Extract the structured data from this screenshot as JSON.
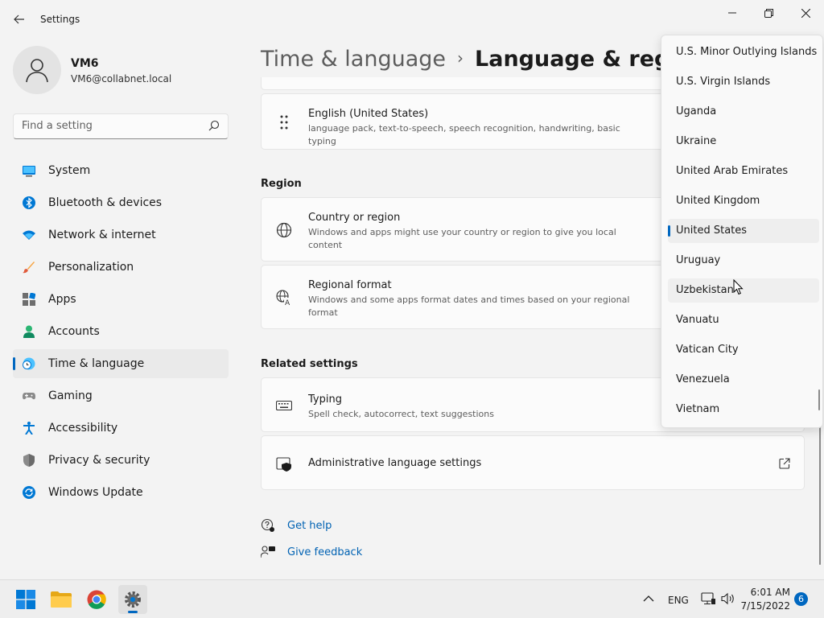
{
  "window": {
    "app_title": "Settings",
    "icons": {
      "back": "back-arrow-icon",
      "minimize": "minimize-icon",
      "maximize": "restore-icon",
      "close": "close-icon"
    }
  },
  "profile": {
    "name": "VM6",
    "email": "VM6@collabnet.local"
  },
  "search": {
    "placeholder": "Find a setting",
    "value": ""
  },
  "sidebar": {
    "items": [
      {
        "label": "System",
        "icon": "system-icon",
        "active": false
      },
      {
        "label": "Bluetooth & devices",
        "icon": "bluetooth-icon",
        "active": false
      },
      {
        "label": "Network & internet",
        "icon": "wifi-icon",
        "active": false
      },
      {
        "label": "Personalization",
        "icon": "brush-icon",
        "active": false
      },
      {
        "label": "Apps",
        "icon": "apps-icon",
        "active": false
      },
      {
        "label": "Accounts",
        "icon": "accounts-icon",
        "active": false
      },
      {
        "label": "Time & language",
        "icon": "globe-clock-icon",
        "active": true
      },
      {
        "label": "Gaming",
        "icon": "gamepad-icon",
        "active": false
      },
      {
        "label": "Accessibility",
        "icon": "accessibility-icon",
        "active": false
      },
      {
        "label": "Privacy & security",
        "icon": "shield-icon",
        "active": false
      },
      {
        "label": "Windows Update",
        "icon": "update-icon",
        "active": false
      }
    ]
  },
  "breadcrumb": {
    "parent": "Time & language",
    "separator": "›",
    "current": "Language & region"
  },
  "language_card": {
    "title": "English (United States)",
    "description": "language pack, text-to-speech, speech recognition, handwriting, basic typing"
  },
  "region": {
    "section_title": "Region",
    "country": {
      "title": "Country or region",
      "description": "Windows and apps might use your country or region to give you local content"
    },
    "format": {
      "title": "Regional format",
      "description": "Windows and some apps format dates and times based on your regional format"
    }
  },
  "related": {
    "section_title": "Related settings",
    "typing": {
      "title": "Typing",
      "description": "Spell check, autocorrect, text suggestions"
    },
    "admin": {
      "title": "Administrative language settings"
    }
  },
  "help_links": {
    "get_help": "Get help",
    "give_feedback": "Give feedback"
  },
  "country_dropdown": {
    "options": [
      "U.S. Minor Outlying Islands",
      "U.S. Virgin Islands",
      "Uganda",
      "Ukraine",
      "United Arab Emirates",
      "United Kingdom",
      "United States",
      "Uruguay",
      "Uzbekistan",
      "Vanuatu",
      "Vatican City",
      "Venezuela",
      "Vietnam"
    ],
    "selected": "United States",
    "hovered": "Uzbekistan"
  },
  "taskbar": {
    "apps": [
      "start-icon",
      "file-explorer-icon",
      "chrome-icon",
      "settings-icon"
    ],
    "language": "ENG",
    "time": "6:01 AM",
    "date": "7/15/2022",
    "notification_count": "6"
  },
  "colors": {
    "accent": "#0067c0",
    "link": "#0062b3",
    "background": "#f3f3f3",
    "card": "#fbfbfb"
  }
}
